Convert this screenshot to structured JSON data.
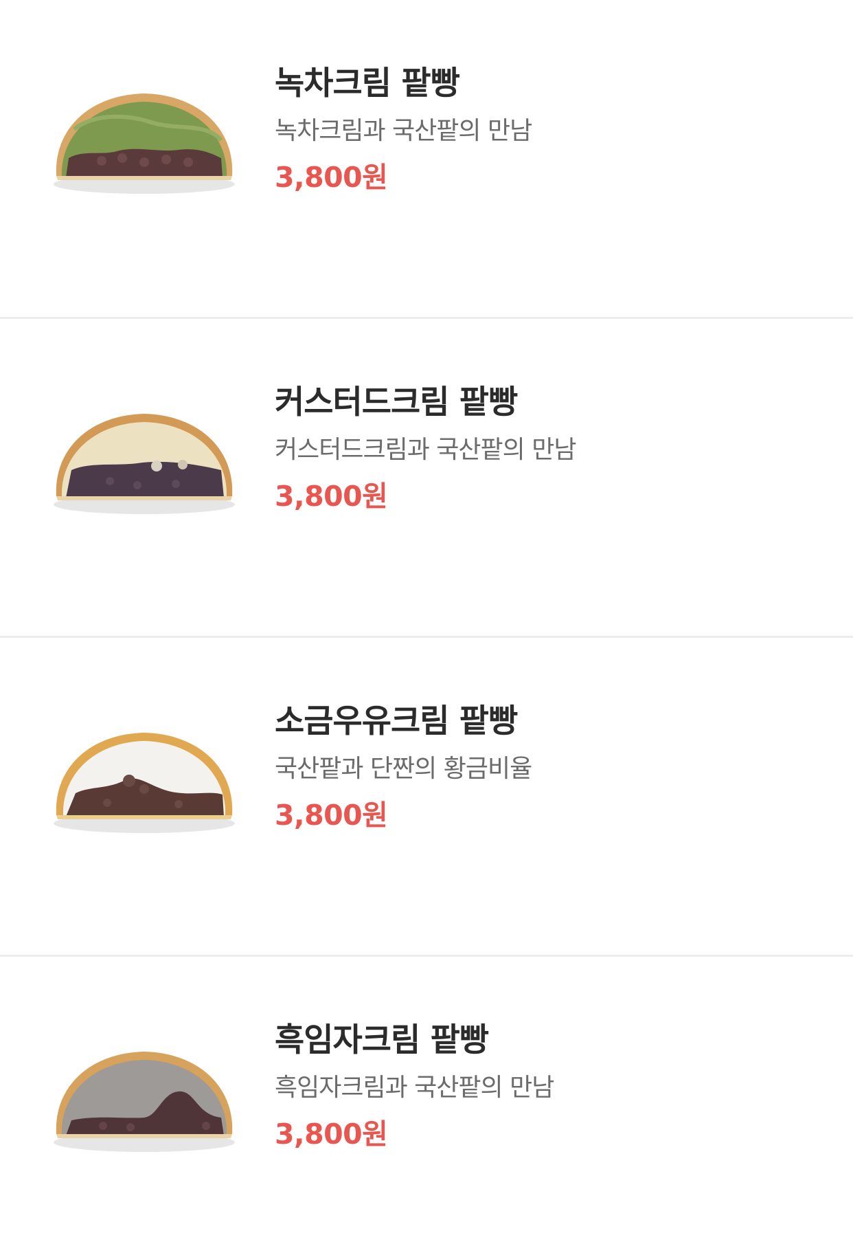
{
  "colors": {
    "name_text": "#2b2b2b",
    "desc_text": "#6b6b6b",
    "price_text": "#e8564f",
    "divider": "#ececec"
  },
  "items": [
    {
      "name": "녹차크림 팥빵",
      "description": "녹차크림과 국산팥의 만남",
      "price": "3,800원",
      "image": "greentea-cream-bun-cross-section",
      "filling_color": "#7e9a4f"
    },
    {
      "name": "커스터드크림 팥빵",
      "description": "커스터드크림과 국산팥의 만남",
      "price": "3,800원",
      "image": "custard-cream-bun-cross-section",
      "filling_color": "#ece2c2"
    },
    {
      "name": "소금우유크림 팥빵",
      "description": "국산팥과 단짠의 황금비율",
      "price": "3,800원",
      "image": "salt-milk-cream-bun-cross-section",
      "filling_color": "#f4f2ee"
    },
    {
      "name": "흑임자크림 팥빵",
      "description": "흑임자크림과 국산팥의 만남",
      "price": "3,800원",
      "image": "black-sesame-cream-bun-cross-section",
      "filling_color": "#9d9a98"
    }
  ]
}
